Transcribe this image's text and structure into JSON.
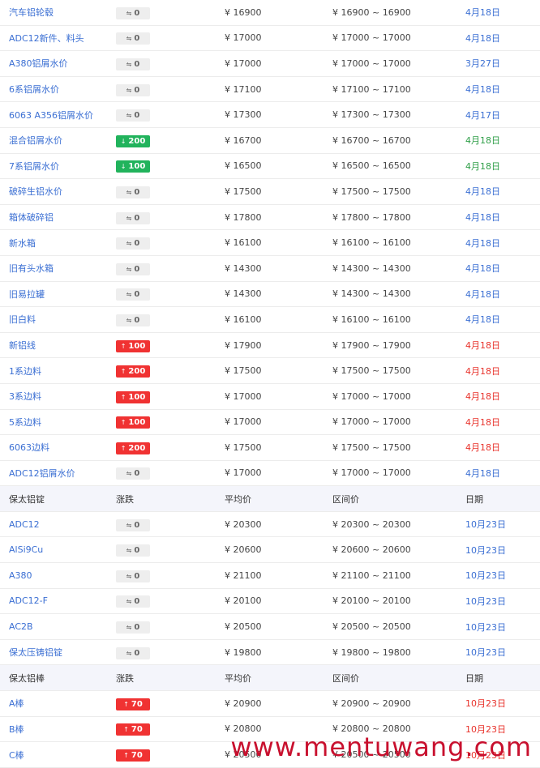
{
  "colors": {
    "up": "#f03232",
    "down": "#21b35c",
    "flat": "#eeeeee",
    "link": "#3b6fd3",
    "header_bg": "#f4f5fb"
  },
  "rows": [
    {
      "type": "data",
      "name": "汽车铝轮毂",
      "trend": "flat",
      "change": "0",
      "avg": "¥ 16900",
      "range": "¥ 16900 ~ 16900",
      "date": "4月18日"
    },
    {
      "type": "data",
      "name": "ADC12新件、料头",
      "trend": "flat",
      "change": "0",
      "avg": "¥ 17000",
      "range": "¥ 17000 ~ 17000",
      "date": "4月18日"
    },
    {
      "type": "data",
      "name": "A380铝屑水价",
      "trend": "flat",
      "change": "0",
      "avg": "¥ 17000",
      "range": "¥ 17000 ~ 17000",
      "date": "3月27日"
    },
    {
      "type": "data",
      "name": "6系铝屑水价",
      "trend": "flat",
      "change": "0",
      "avg": "¥ 17100",
      "range": "¥ 17100 ~ 17100",
      "date": "4月18日"
    },
    {
      "type": "data",
      "name": "6063 A356铝屑水价",
      "trend": "flat",
      "change": "0",
      "avg": "¥ 17300",
      "range": "¥ 17300 ~ 17300",
      "date": "4月17日"
    },
    {
      "type": "data",
      "name": "混合铝屑水价",
      "trend": "down",
      "change": "200",
      "avg": "¥ 16700",
      "range": "¥ 16700 ~ 16700",
      "date": "4月18日"
    },
    {
      "type": "data",
      "name": "7系铝屑水价",
      "trend": "down",
      "change": "100",
      "avg": "¥ 16500",
      "range": "¥ 16500 ~ 16500",
      "date": "4月18日"
    },
    {
      "type": "data",
      "name": "破碎生铝水价",
      "trend": "flat",
      "change": "0",
      "avg": "¥ 17500",
      "range": "¥ 17500 ~ 17500",
      "date": "4月18日"
    },
    {
      "type": "data",
      "name": "箱体破碎铝",
      "trend": "flat",
      "change": "0",
      "avg": "¥ 17800",
      "range": "¥ 17800 ~ 17800",
      "date": "4月18日"
    },
    {
      "type": "data",
      "name": "新水箱",
      "trend": "flat",
      "change": "0",
      "avg": "¥ 16100",
      "range": "¥ 16100 ~ 16100",
      "date": "4月18日"
    },
    {
      "type": "data",
      "name": "旧有头水箱",
      "trend": "flat",
      "change": "0",
      "avg": "¥ 14300",
      "range": "¥ 14300 ~ 14300",
      "date": "4月18日"
    },
    {
      "type": "data",
      "name": "旧易拉罐",
      "trend": "flat",
      "change": "0",
      "avg": "¥ 14300",
      "range": "¥ 14300 ~ 14300",
      "date": "4月18日"
    },
    {
      "type": "data",
      "name": "旧白料",
      "trend": "flat",
      "change": "0",
      "avg": "¥ 16100",
      "range": "¥ 16100 ~ 16100",
      "date": "4月18日"
    },
    {
      "type": "data",
      "name": "新铝线",
      "trend": "up",
      "change": "100",
      "avg": "¥ 17900",
      "range": "¥ 17900 ~ 17900",
      "date": "4月18日"
    },
    {
      "type": "data",
      "name": "1系边料",
      "trend": "up",
      "change": "200",
      "avg": "¥ 17500",
      "range": "¥ 17500 ~ 17500",
      "date": "4月18日"
    },
    {
      "type": "data",
      "name": "3系边料",
      "trend": "up",
      "change": "100",
      "avg": "¥ 17000",
      "range": "¥ 17000 ~ 17000",
      "date": "4月18日"
    },
    {
      "type": "data",
      "name": "5系边料",
      "trend": "up",
      "change": "100",
      "avg": "¥ 17000",
      "range": "¥ 17000 ~ 17000",
      "date": "4月18日"
    },
    {
      "type": "data",
      "name": "6063边料",
      "trend": "up",
      "change": "200",
      "avg": "¥ 17500",
      "range": "¥ 17500 ~ 17500",
      "date": "4月18日"
    },
    {
      "type": "data",
      "name": "ADC12铝屑水价",
      "trend": "flat",
      "change": "0",
      "avg": "¥ 17000",
      "range": "¥ 17000 ~ 17000",
      "date": "4月18日"
    },
    {
      "type": "header",
      "name": "保太铝锭",
      "change": "涨跌",
      "avg": "平均价",
      "range": "区间价",
      "date": "日期"
    },
    {
      "type": "data",
      "name": "ADC12",
      "trend": "flat",
      "change": "0",
      "avg": "¥ 20300",
      "range": "¥ 20300 ~ 20300",
      "date": "10月23日"
    },
    {
      "type": "data",
      "name": "AlSi9Cu",
      "trend": "flat",
      "change": "0",
      "avg": "¥ 20600",
      "range": "¥ 20600 ~ 20600",
      "date": "10月23日"
    },
    {
      "type": "data",
      "name": "A380",
      "trend": "flat",
      "change": "0",
      "avg": "¥ 21100",
      "range": "¥ 21100 ~ 21100",
      "date": "10月23日"
    },
    {
      "type": "data",
      "name": "ADC12-F",
      "trend": "flat",
      "change": "0",
      "avg": "¥ 20100",
      "range": "¥ 20100 ~ 20100",
      "date": "10月23日"
    },
    {
      "type": "data",
      "name": "AC2B",
      "trend": "flat",
      "change": "0",
      "avg": "¥ 20500",
      "range": "¥ 20500 ~ 20500",
      "date": "10月23日"
    },
    {
      "type": "data",
      "name": "保太压铸铝锭",
      "trend": "flat",
      "change": "0",
      "avg": "¥ 19800",
      "range": "¥ 19800 ~ 19800",
      "date": "10月23日"
    },
    {
      "type": "header",
      "name": "保太铝棒",
      "change": "涨跌",
      "avg": "平均价",
      "range": "区间价",
      "date": "日期"
    },
    {
      "type": "data",
      "name": "A棒",
      "trend": "up",
      "change": "70",
      "avg": "¥ 20900",
      "range": "¥ 20900 ~ 20900",
      "date": "10月23日"
    },
    {
      "type": "data",
      "name": "B棒",
      "trend": "up",
      "change": "70",
      "avg": "¥ 20800",
      "range": "¥ 20800 ~ 20800",
      "date": "10月23日"
    },
    {
      "type": "data",
      "name": "C棒",
      "trend": "up",
      "change": "70",
      "avg": "¥ 20500",
      "range": "¥ 20500 ~ 20500",
      "date": "10月23日"
    }
  ],
  "watermark": "www.mentuwang.com"
}
